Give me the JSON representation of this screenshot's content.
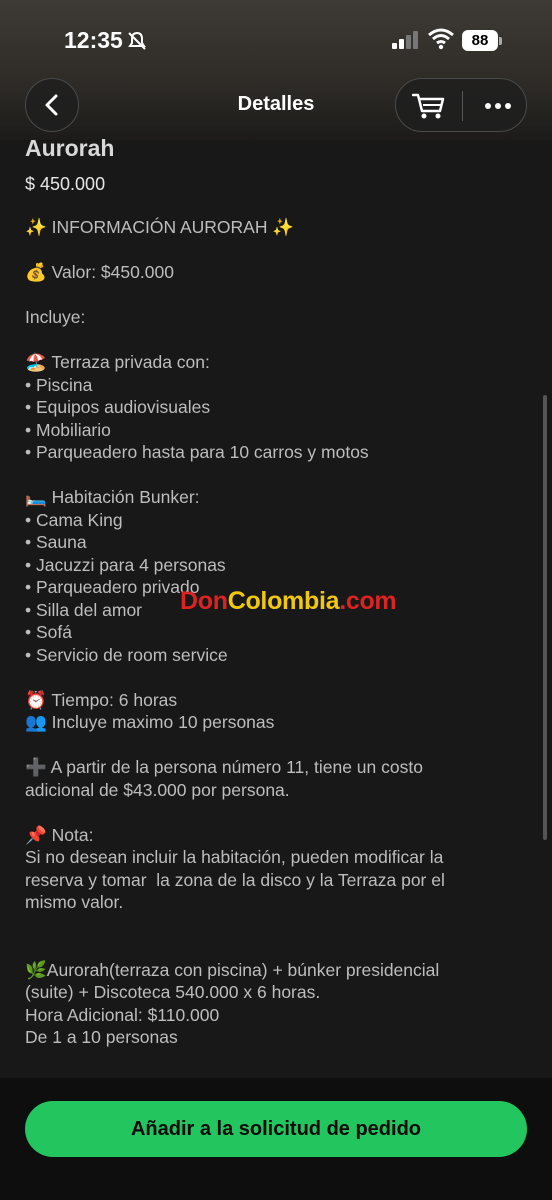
{
  "status_bar": {
    "time": "12:35",
    "battery": "88"
  },
  "nav": {
    "title": "Detalles",
    "back_icon": "chevron-left-icon",
    "cart_icon": "cart-icon",
    "more_icon": "more-horizontal-icon"
  },
  "product": {
    "title": "Aurorah",
    "price": "$ 450.000"
  },
  "description_lines": [
    "✨ INFORMACIÓN AURORAH ✨",
    "",
    "💰 Valor: $450.000",
    "",
    "Incluye:",
    "",
    "🏖️ Terraza privada con:",
    "• Piscina",
    "• Equipos audiovisuales",
    "• Mobiliario",
    "• Parqueadero hasta para 10 carros y motos",
    "",
    "🛏️ Habitación Bunker:",
    "• Cama King",
    "• Sauna",
    "• Jacuzzi para 4 personas",
    "• Parqueadero privado",
    "• Silla del amor",
    "• Sofá",
    "• Servicio de room service",
    "",
    "⏰ Tiempo: 6 horas",
    "👥 Incluye maximo 10 personas",
    "",
    "➕ A partir de la persona número 11, tiene un costo",
    "adicional de $43.000 por persona.",
    "",
    "📌 Nota:",
    "Si no desean incluir la habitación, pueden modificar la",
    "reserva y tomar  la zona de la disco y la Terraza por el",
    "mismo valor.",
    "",
    "",
    "🌿Aurorah(terraza con piscina) + búnker presidencial",
    "(suite) + Discoteca 540.000 x 6 horas.",
    "Hora Adicional: $110.000",
    "De 1 a 10 personas"
  ],
  "watermark": {
    "part1": "Don",
    "part2": "Colombia",
    "part3": ".com"
  },
  "cta_label": "Añadir a la solicitud de pedido",
  "colors": {
    "accent": "#22c55e",
    "background": "#181818"
  }
}
